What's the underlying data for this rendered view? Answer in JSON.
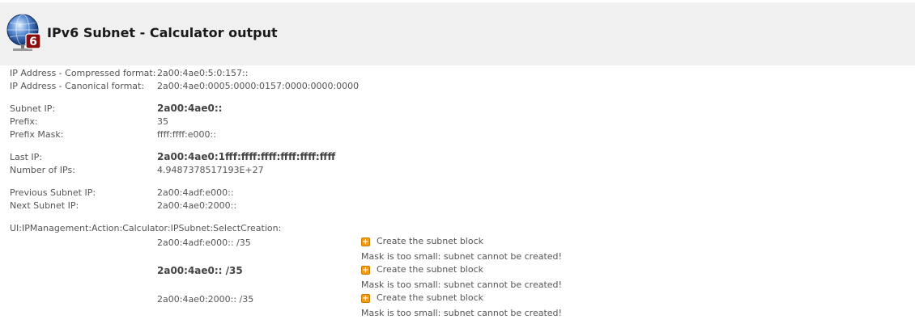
{
  "header": {
    "title": "IPv6 Subnet - Calculator output",
    "badge": "6"
  },
  "rows": {
    "compressed": {
      "label": "IP Address - Compressed format:",
      "value": "2a00:4ae0:5:0:157::"
    },
    "canonical": {
      "label": "IP Address - Canonical format:",
      "value": "2a00:4ae0:0005:0000:0157:0000:0000:0000"
    },
    "subnet_ip": {
      "label": "Subnet IP:",
      "value": "2a00:4ae0::"
    },
    "prefix": {
      "label": "Prefix:",
      "value": "35"
    },
    "prefix_mask": {
      "label": "Prefix Mask:",
      "value": "ffff:ffff:e000::"
    },
    "last_ip": {
      "label": "Last IP:",
      "value": "2a00:4ae0:1fff:ffff:ffff:ffff:ffff:ffff"
    },
    "num_ips": {
      "label": "Number of IPs:",
      "value": "4.9487378517193E+27"
    },
    "prev_subnet": {
      "label": "Previous Subnet IP:",
      "value": "2a00:4adf:e000::"
    },
    "next_subnet": {
      "label": "Next Subnet IP:",
      "value": "2a00:4ae0:2000::"
    }
  },
  "select_creation": {
    "label": "UI:IPManagement:Action:Calculator:IPSubnet:SelectCreation:",
    "items": [
      {
        "subnet": "2a00:4adf:e000:: /35",
        "action": "Create the subnet block",
        "message": "Mask is too small: subnet cannot be created!"
      },
      {
        "subnet": "2a00:4ae0:: /35",
        "action": "Create the subnet block",
        "message": "Mask is too small: subnet cannot be created!"
      },
      {
        "subnet": "2a00:4ae0:2000:: /35",
        "action": "Create the subnet block",
        "message": "Mask is too small: subnet cannot be created!"
      }
    ]
  }
}
